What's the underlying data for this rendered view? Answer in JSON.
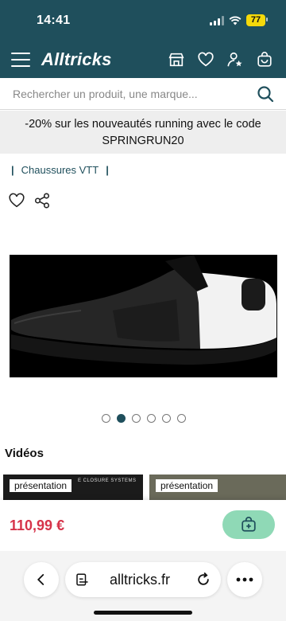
{
  "status_bar": {
    "time": "14:41",
    "battery": "77"
  },
  "header": {
    "logo": "Alltricks",
    "icons": [
      "menu-icon",
      "store-icon",
      "heart-icon",
      "account-star-icon",
      "basket-icon"
    ],
    "brand_color": "#1f4f5c"
  },
  "search": {
    "placeholder": "Rechercher un produit, une marque..."
  },
  "promo": {
    "line1": "-20% sur les nouveautés running avec le code",
    "line2": "SPRINGRUN20"
  },
  "breadcrumb": {
    "sep": "|",
    "item": "Chaussures VTT"
  },
  "product": {
    "image_alt": "Chaussure VTT noire et blanche",
    "carousel": {
      "count": 6,
      "active_index": 1
    }
  },
  "videos": {
    "title": "Vidéos",
    "items": [
      {
        "tag": "présentation",
        "overlay_text": "E CLOSURE SYSTEMS"
      },
      {
        "tag": "présentation"
      }
    ]
  },
  "purchase": {
    "price": "110,99 €",
    "price_color": "#d6334a",
    "cart_button_color": "#8fd9b6"
  },
  "browser": {
    "url": "alltricks.fr"
  }
}
